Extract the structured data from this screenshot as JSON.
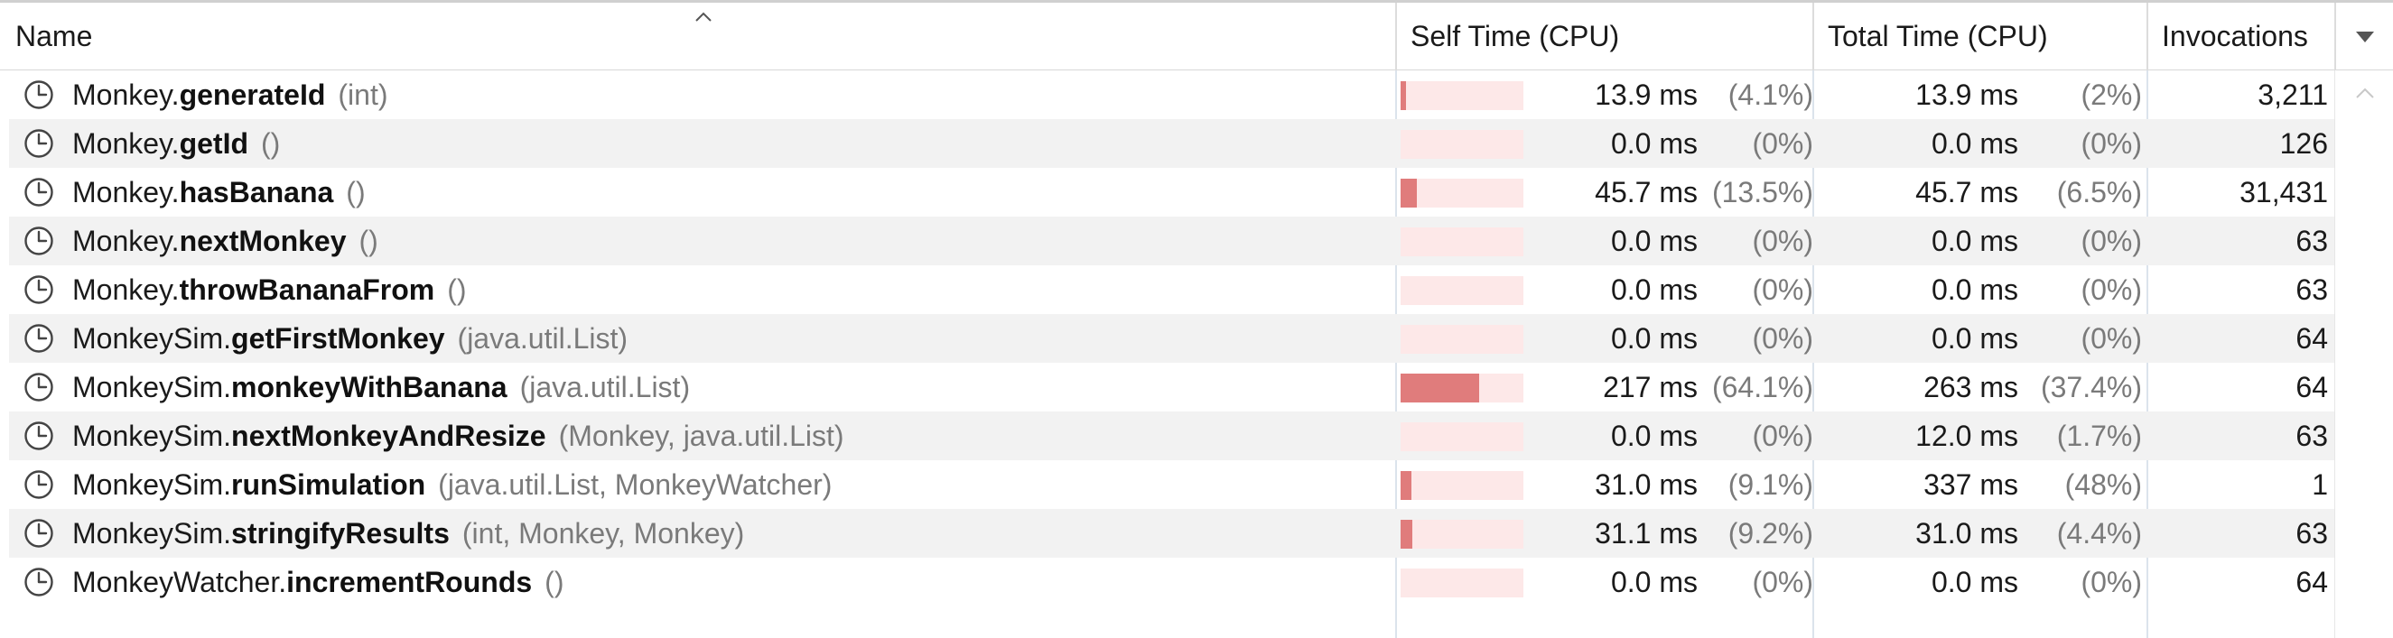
{
  "header": {
    "name": "Name",
    "self_time": "Self Time (CPU)",
    "total_time": "Total Time (CPU)",
    "invocations": "Invocations",
    "sort_icon": "sort-ascending-caret-icon",
    "menu_icon": "column-menu-dropdown-icon"
  },
  "colors": {
    "bar_fill": "#e07c7c",
    "bar_background": "#fde8e8",
    "row_alternate": "#f2f2f2",
    "muted_text": "#7a7a7a"
  },
  "rows": [
    {
      "cls": "Monkey.",
      "method": "generateId",
      "params": "(int)",
      "self_ms": "13.9 ms",
      "self_pct": "(4.1%)",
      "self_share": 0.041,
      "total_ms": "13.9 ms",
      "total_pct": "(2%)",
      "invocations": "3,211"
    },
    {
      "cls": "Monkey.",
      "method": "getId",
      "params": "()",
      "self_ms": "0.0 ms",
      "self_pct": "(0%)",
      "self_share": 0.0,
      "total_ms": "0.0 ms",
      "total_pct": "(0%)",
      "invocations": "126"
    },
    {
      "cls": "Monkey.",
      "method": "hasBanana",
      "params": "()",
      "self_ms": "45.7 ms",
      "self_pct": "(13.5%)",
      "self_share": 0.135,
      "total_ms": "45.7 ms",
      "total_pct": "(6.5%)",
      "invocations": "31,431"
    },
    {
      "cls": "Monkey.",
      "method": "nextMonkey",
      "params": "()",
      "self_ms": "0.0 ms",
      "self_pct": "(0%)",
      "self_share": 0.0,
      "total_ms": "0.0 ms",
      "total_pct": "(0%)",
      "invocations": "63"
    },
    {
      "cls": "Monkey.",
      "method": "throwBananaFrom",
      "params": "()",
      "self_ms": "0.0 ms",
      "self_pct": "(0%)",
      "self_share": 0.0,
      "total_ms": "0.0 ms",
      "total_pct": "(0%)",
      "invocations": "63"
    },
    {
      "cls": "MonkeySim.",
      "method": "getFirstMonkey",
      "params": "(java.util.List)",
      "self_ms": "0.0 ms",
      "self_pct": "(0%)",
      "self_share": 0.0,
      "total_ms": "0.0 ms",
      "total_pct": "(0%)",
      "invocations": "64"
    },
    {
      "cls": "MonkeySim.",
      "method": "monkeyWithBanana",
      "params": "(java.util.List)",
      "self_ms": "217 ms",
      "self_pct": "(64.1%)",
      "self_share": 0.641,
      "total_ms": "263 ms",
      "total_pct": "(37.4%)",
      "invocations": "64"
    },
    {
      "cls": "MonkeySim.",
      "method": "nextMonkeyAndResize",
      "params": "(Monkey, java.util.List)",
      "self_ms": "0.0 ms",
      "self_pct": "(0%)",
      "self_share": 0.0,
      "total_ms": "12.0 ms",
      "total_pct": "(1.7%)",
      "invocations": "63"
    },
    {
      "cls": "MonkeySim.",
      "method": "runSimulation",
      "params": "(java.util.List, MonkeyWatcher)",
      "self_ms": "31.0 ms",
      "self_pct": "(9.1%)",
      "self_share": 0.091,
      "total_ms": "337 ms",
      "total_pct": "(48%)",
      "invocations": "1"
    },
    {
      "cls": "MonkeySim.",
      "method": "stringifyResults",
      "params": "(int, Monkey, Monkey)",
      "self_ms": "31.1 ms",
      "self_pct": "(9.2%)",
      "self_share": 0.092,
      "total_ms": "31.0 ms",
      "total_pct": "(4.4%)",
      "invocations": "63"
    },
    {
      "cls": "MonkeyWatcher.",
      "method": "incrementRounds",
      "params": "()",
      "self_ms": "0.0 ms",
      "self_pct": "(0%)",
      "self_share": 0.0,
      "total_ms": "0.0 ms",
      "total_pct": "(0%)",
      "invocations": "64"
    }
  ],
  "row_icon": "clock-icon"
}
